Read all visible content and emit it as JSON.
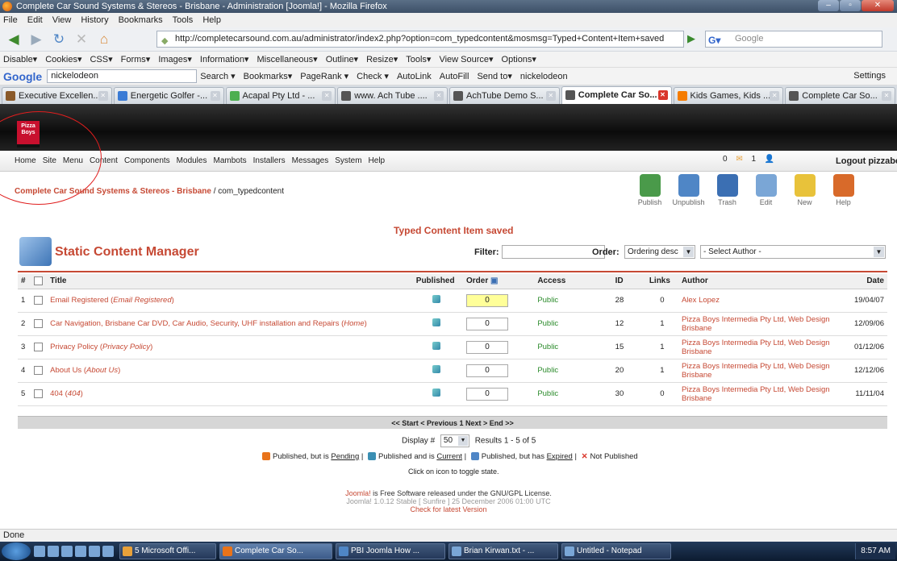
{
  "window": {
    "title": "Complete Car Sound Systems & Stereos - Brisbane - Administration [Joomla!] - Mozilla Firefox"
  },
  "menubar": [
    "File",
    "Edit",
    "View",
    "History",
    "Bookmarks",
    "Tools",
    "Help"
  ],
  "address": {
    "url": "http://completecarsound.com.au/administrator/index2.php?option=com_typedcontent&mosmsg=Typed+Content+Item+saved"
  },
  "gsearch": {
    "placeholder": "Google"
  },
  "webdev": [
    "Disable▾",
    "Cookies▾",
    "CSS▾",
    "Forms▾",
    "Images▾",
    "Information▾",
    "Miscellaneous▾",
    "Outline▾",
    "Resize▾",
    "Tools▾",
    "View Source▾",
    "Options▾"
  ],
  "googlebar": {
    "logo": "Google",
    "query": "nickelodeon",
    "items": [
      "Search ▾",
      "Bookmarks▾",
      "PageRank ▾",
      "Check ▾",
      "AutoLink",
      "AutoFill",
      "Send to▾",
      "nickelodeon"
    ],
    "settings": "Settings"
  },
  "tabs": [
    {
      "label": "Executive Excellen...",
      "color": "#8a5a2a"
    },
    {
      "label": "Energetic Golfer -...",
      "color": "#3a7bd5"
    },
    {
      "label": "Acapal Pty Ltd - ...",
      "color": "#4caf50"
    },
    {
      "label": "www. Ach Tube ....",
      "color": "#555"
    },
    {
      "label": "AchTube Demo S...",
      "color": "#555"
    },
    {
      "label": "Complete Car So...",
      "color": "#555",
      "active": true
    },
    {
      "label": "Kids Games, Kids ...",
      "color": "#f57c00"
    },
    {
      "label": "Complete Car So...",
      "color": "#555"
    }
  ],
  "logo": {
    "text": "Pizza Boys intermedia"
  },
  "jmenu": {
    "items": [
      "Home",
      "Site",
      "Menu",
      "Content",
      "Components",
      "Modules",
      "Mambots",
      "Installers",
      "Messages",
      "System",
      "Help"
    ],
    "stat1": "0",
    "stat2": "1",
    "logout": "Logout pizzaboy"
  },
  "breadcrumb": {
    "site": "Complete Car Sound Systems & Stereos - Brisbane",
    "path": " / com_typedcontent"
  },
  "toolbar": [
    {
      "label": "Publish",
      "color": "#4a9a4a"
    },
    {
      "label": "Unpublish",
      "color": "#4f86c6"
    },
    {
      "label": "Trash",
      "color": "#3b6fb3"
    },
    {
      "label": "Edit",
      "color": "#7aa6d6"
    },
    {
      "label": "New",
      "color": "#e8c23a"
    },
    {
      "label": "Help",
      "color": "#d86a2a"
    }
  ],
  "message": "Typed Content Item saved",
  "manager": {
    "title": "Static Content Manager",
    "filter_label": "Filter:",
    "order_label": "Order:",
    "order_value": "Ordering desc",
    "author_value": "- Select Author -"
  },
  "table": {
    "headers": [
      "#",
      "Title",
      "Published",
      "Order",
      "Access",
      "ID",
      "Links",
      "Author",
      "Date"
    ],
    "rows": [
      {
        "n": "1",
        "title": "Email Registered",
        "alias": "Email Registered",
        "order": "0",
        "access": "Public",
        "id": "28",
        "links": "0",
        "author": "Alex Lopez",
        "date": "19/04/07"
      },
      {
        "n": "2",
        "title": "Car Navigation, Brisbane Car DVD, Car Audio, Security, UHF installation and Repairs",
        "alias": "Home",
        "order": "0",
        "access": "Public",
        "id": "12",
        "links": "1",
        "author": "Pizza Boys Intermedia Pty Ltd, Web Design Brisbane",
        "date": "12/09/06"
      },
      {
        "n": "3",
        "title": "Privacy Policy",
        "alias": "Privacy Policy",
        "order": "0",
        "access": "Public",
        "id": "15",
        "links": "1",
        "author": "Pizza Boys Intermedia Pty Ltd, Web Design Brisbane",
        "date": "01/12/06"
      },
      {
        "n": "4",
        "title": "About Us",
        "alias": "About Us",
        "order": "0",
        "access": "Public",
        "id": "20",
        "links": "1",
        "author": "Pizza Boys Intermedia Pty Ltd, Web Design Brisbane",
        "date": "12/12/06"
      },
      {
        "n": "5",
        "title": "404",
        "alias": "404",
        "order": "0",
        "access": "Public",
        "id": "30",
        "links": "0",
        "author": "Pizza Boys Intermedia Pty Ltd, Web Design Brisbane",
        "date": "11/11/04"
      }
    ]
  },
  "pager": "<< Start < Previous 1 Next > End >>",
  "display": {
    "label": "Display #",
    "value": "50",
    "results": "Results 1 - 5 of 5"
  },
  "legend": {
    "a": "Published, but is ",
    "a_link": "Pending",
    "b": "Published and is ",
    "b_link": "Current",
    "c": "Published, but has ",
    "c_link": "Expired",
    "d": "Not Published"
  },
  "clicktip": "Click on icon to toggle state.",
  "footer": {
    "l1a": "Joomla!",
    "l1b": " is Free Software released under the GNU/GPL License.",
    "l2": "Joomla! 1.0.12 Stable [ Sunfire ] 25 December 2006 01:00 UTC",
    "l3": "Check for latest Version"
  },
  "statusbar": "Done",
  "taskbar": [
    {
      "label": "5 Microsoft Offi...",
      "color": "#e8a13a"
    },
    {
      "label": "Complete Car So...",
      "color": "#e8731a",
      "active": true
    },
    {
      "label": "PBI Joomla How ...",
      "color": "#4f86c6"
    },
    {
      "label": "Brian Kirwan.txt - ...",
      "color": "#7aa6d6"
    },
    {
      "label": "Untitled - Notepad",
      "color": "#7aa6d6"
    }
  ],
  "clock": "8:57 AM"
}
